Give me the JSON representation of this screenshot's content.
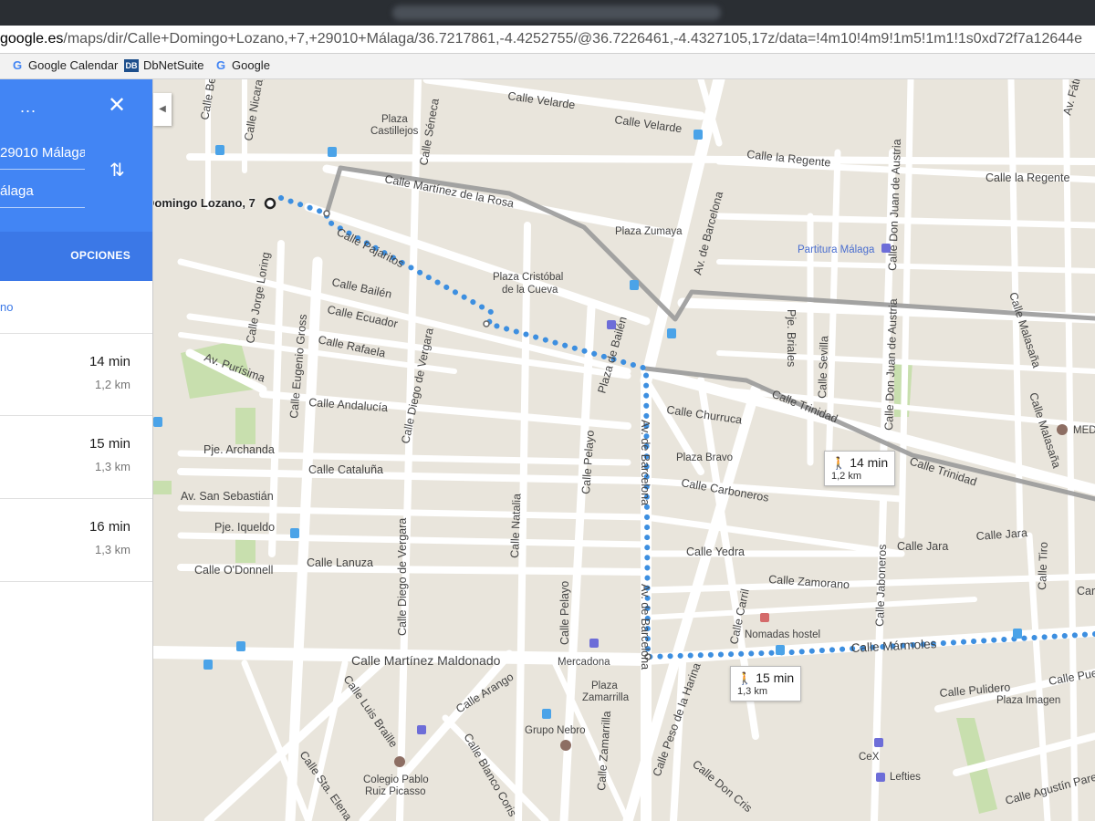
{
  "browser": {
    "url_host": "google.es",
    "url_path": "/maps/dir/Calle+Domingo+Lozano,+7,+29010+Málaga/36.7217861,-4.4252755/@36.7226461,-4.4327105,17z/data=!4m10!4m9!1m5!1m1!1s0xd72f7a12644e",
    "bookmarks": [
      {
        "icon": "google-g-icon",
        "label": "Google Calendar"
      },
      {
        "icon": "dbnetsuite-icon",
        "label": "DbNetSuite"
      },
      {
        "icon": "google-g-icon",
        "label": "Google"
      }
    ]
  },
  "sidebar": {
    "menu_dots": "...",
    "close_glyph": "✕",
    "origin_field": "29010 Málaga",
    "destination_field": "álaga",
    "swap_glyph": "⇅",
    "opciones_label": "OPCIONES",
    "link_text": "no",
    "routes": [
      {
        "time": "14 min",
        "distance": "1,2 km"
      },
      {
        "time": "15 min",
        "distance": "1,3 km"
      },
      {
        "time": "16 min",
        "distance": "1,3 km"
      }
    ],
    "accent_color": "#4285f4"
  },
  "map": {
    "origin_label": "Domingo Lozano, 7",
    "route_boxes": [
      {
        "time": "14 min",
        "distance": "1,2 km"
      },
      {
        "time": "15 min",
        "distance": "1,3 km"
      }
    ],
    "streets": {
      "velarde1": "Calle Velarde",
      "velarde2": "Calle Velarde",
      "martinez_rosa": "Calle Martínez de la Rosa",
      "pajaritos": "Calle Pajaritos",
      "bailen": "Calle Bailén",
      "ecuador": "Calle Ecuador",
      "rafaela": "Calle Rafaela",
      "purisima": "Av. Purísima",
      "andalucia": "Calle Andalucía",
      "archanda": "Pje. Archanda",
      "cataluna": "Calle Cataluña",
      "san_sebastian": "Av. San Sebastián",
      "iquel": "Pje. Iqueldo",
      "odonnell": "Calle O'Donnell",
      "lanuza": "Calle Lanuza",
      "martinez_maldonado": "Calle Martínez Maldonado",
      "arango": "Calle Arango",
      "luis_braille": "Calle Luis Braille",
      "sta_elena": "Calle Sta. Elena",
      "blanco_coris": "Calle Blanco Coris",
      "jorge_loring": "Calle Jorge Loring",
      "eugenio_gross": "Calle Eugenio Gross",
      "diego_vergara1": "Calle Diego de Vergara",
      "diego_vergara2": "Calle Diego de Vergara",
      "natalia": "Calle Natalia",
      "pelayo1": "Calle Pelayo",
      "pelayo2": "Calle Pelayo",
      "plaza_bailen": "Plaza de Bailén",
      "av_barcelona1": "Av. de Barcelona",
      "av_barcelona2": "Av. de Barcelona",
      "av_barcelona3": "Av. de Barcelona",
      "churruca": "Calle Churruca",
      "carboneros": "Calle Carboneros",
      "yedra": "Calle Yedra",
      "zamorano": "Calle Zamorano",
      "marmoles": "Calle Mármoles",
      "trinidad1": "Calle Trinidad",
      "trinidad2": "Calle Trinidad",
      "la_regente1": "Calle la Regente",
      "la_regente2": "Calle la Regente",
      "jara1": "Calle Jara",
      "jara2": "Calle Jara",
      "pulidero": "Calle Pulidero",
      "pje_briales": "Pje. Briales",
      "sevilla": "Calle Sevilla",
      "don_juan_austria1": "Calle Don Juan de Austria",
      "don_juan_austria2": "Calle Don Juan de Austria",
      "malasana1": "Calle Malasaña",
      "malasana2": "Calle Malasaña",
      "tiro": "Calle Tiro",
      "jaboneros": "Calle Jaboneros",
      "carril": "Calle Carril",
      "peso_harina": "Calle Peso de la Harina",
      "zamarrilla": "Calle Zamarrilla",
      "don_cris": "Calle Don Cris",
      "agustin_pare": "Calle Agustín Pare",
      "nicaragua": "Calle Nicaragua",
      "seneca": "Calle Séneca",
      "av_fatima": "Av. Fátima",
      "calle_be": "Calle Be",
      "calle_pue": "Calle Pue",
      "cari": "Cari"
    },
    "pois": {
      "plaza_castillejos": [
        "Plaza",
        "Castillejos"
      ],
      "plaza_zumaya": "Plaza Zumaya",
      "plaza_cristobal": [
        "Plaza Cristóbal",
        "de la Cueva"
      ],
      "partitura": "Partitura Málaga",
      "plaza_bravo": "Plaza Bravo",
      "nomadas": "Nomadas hostel",
      "mercadona": "Mercadona",
      "plaza_zamarrilla": [
        "Plaza",
        "Zamarrilla"
      ],
      "grupo_nebro": "Grupo Nebro",
      "colegio": [
        "Colegio Pablo",
        "Ruiz Picasso"
      ],
      "plaza_imagen": "Plaza Imagen",
      "cex": "CeX",
      "lefties": "Lefties",
      "med": "MED"
    },
    "colors": {
      "route_blue": "#3d8fe0",
      "alt_route_gray": "#9a9a9a",
      "road": "#ffffff",
      "block": "#e9e5dc",
      "park": "#c8dfae"
    }
  }
}
